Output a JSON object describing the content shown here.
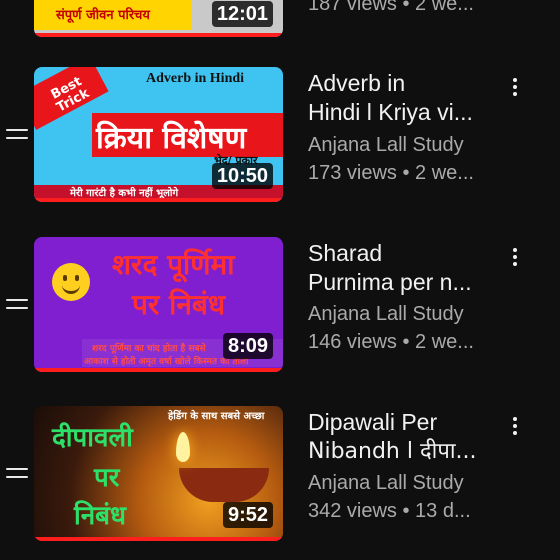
{
  "colors": {
    "background": "#0f0f0f",
    "progress": "#ff1e1e",
    "meta": "#aaaaaa"
  },
  "top_item": {
    "duration": "12:01",
    "thumb_text": "संपूर्ण जीवन परिचय",
    "meta": "187 views • 2 we..."
  },
  "items": [
    {
      "title_line1": "Adverb in",
      "title_line2": "Hindi l Kriya vi...",
      "channel": "Anjana Lall Study",
      "stats": "173 views • 2 we...",
      "duration": "10:50",
      "thumb": {
        "badge": "Best Trick",
        "heading": "Adverb in Hindi",
        "main": "क्रिया विशेषण",
        "sub": "भेद/ प्रकार",
        "footer": "मेरी गारंटी है कभी नहीं भूलोगे"
      }
    },
    {
      "title_line1": "Sharad",
      "title_line2": "Purnima per n...",
      "channel": "Anjana Lall Study",
      "stats": "146 views • 2 we...",
      "duration": "8:09",
      "thumb": {
        "line1": "शरद पूर्णिमा",
        "line2": "पर निबंध",
        "footer1": "शरद पूर्णिमा का चांद होता है सबसे",
        "footer2": "आकाश से होती अमृत वर्षा खोले किस्मत का ताला"
      }
    },
    {
      "title_line1": "Dipawali Per",
      "title_line2": "Nibandh l दीपा...",
      "channel": "Anjana Lall Study",
      "stats": "342 views • 13 d...",
      "duration": "9:52",
      "thumb": {
        "top": "हेडिंग के साथ सबसे अच्छा",
        "line1": "दीपावली",
        "line2": "पर",
        "line3": "निबंध"
      }
    }
  ]
}
